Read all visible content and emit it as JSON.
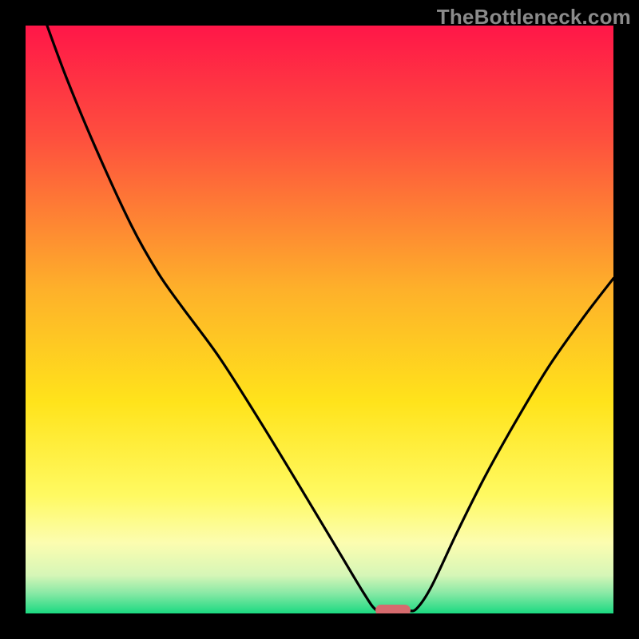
{
  "watermark": "TheBottleneck.com",
  "chart_data": {
    "type": "line",
    "title": "",
    "xlabel": "",
    "ylabel": "",
    "xlim": [
      0,
      100
    ],
    "ylim": [
      0,
      100
    ],
    "grid": false,
    "legend": false,
    "gradient_stops": [
      {
        "pos": 0,
        "color": "#FF1648"
      },
      {
        "pos": 0.19,
        "color": "#FE4F3E"
      },
      {
        "pos": 0.45,
        "color": "#FEB12A"
      },
      {
        "pos": 0.64,
        "color": "#FFE31B"
      },
      {
        "pos": 0.8,
        "color": "#FFFA62"
      },
      {
        "pos": 0.88,
        "color": "#FCFDB0"
      },
      {
        "pos": 0.935,
        "color": "#D6F6B7"
      },
      {
        "pos": 0.965,
        "color": "#8AE9A6"
      },
      {
        "pos": 1.0,
        "color": "#1BD981"
      }
    ],
    "series": [
      {
        "name": "bottleneck-curve",
        "color": "#000000",
        "points": [
          {
            "x": 3.3,
            "y": 101.0
          },
          {
            "x": 7.0,
            "y": 91.0
          },
          {
            "x": 12.0,
            "y": 79.0
          },
          {
            "x": 18.0,
            "y": 66.0
          },
          {
            "x": 22.5,
            "y": 58.0
          },
          {
            "x": 26.5,
            "y": 52.3
          },
          {
            "x": 33.0,
            "y": 43.5
          },
          {
            "x": 40.0,
            "y": 32.5
          },
          {
            "x": 47.0,
            "y": 21.0
          },
          {
            "x": 53.0,
            "y": 11.0
          },
          {
            "x": 57.5,
            "y": 3.5
          },
          {
            "x": 59.5,
            "y": 0.7
          },
          {
            "x": 61.0,
            "y": 0.5
          },
          {
            "x": 63.0,
            "y": 0.5
          },
          {
            "x": 65.0,
            "y": 0.5
          },
          {
            "x": 66.5,
            "y": 0.8
          },
          {
            "x": 69.0,
            "y": 4.5
          },
          {
            "x": 73.5,
            "y": 14.0
          },
          {
            "x": 78.0,
            "y": 23.0
          },
          {
            "x": 83.0,
            "y": 32.0
          },
          {
            "x": 89.0,
            "y": 42.0
          },
          {
            "x": 95.0,
            "y": 50.5
          },
          {
            "x": 100.0,
            "y": 57.0
          }
        ]
      }
    ],
    "marker": {
      "x_center": 62.5,
      "width": 6.0,
      "y": 0.6,
      "color": "#D66B6E"
    }
  }
}
